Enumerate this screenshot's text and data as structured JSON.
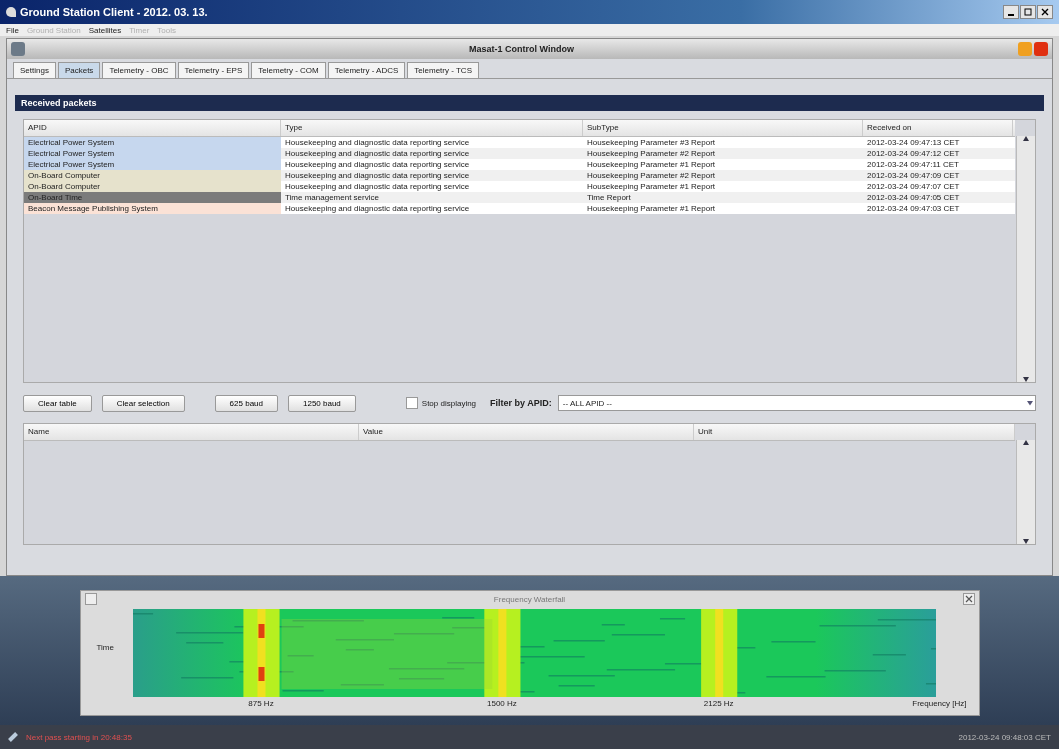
{
  "window": {
    "title": "Ground Station Client - 2012. 03. 13."
  },
  "menu": [
    {
      "label": "File",
      "disabled": false
    },
    {
      "label": "Ground Station",
      "disabled": true
    },
    {
      "label": "Satellites",
      "disabled": false
    },
    {
      "label": "Timer",
      "disabled": true
    },
    {
      "label": "Tools",
      "disabled": true
    }
  ],
  "control_window": {
    "title": "Masat-1 Control Window"
  },
  "tabs": [
    {
      "label": "Settings",
      "selected": false
    },
    {
      "label": "Packets",
      "selected": true
    },
    {
      "label": "Telemetry - OBC",
      "selected": false
    },
    {
      "label": "Telemetry - EPS",
      "selected": false
    },
    {
      "label": "Telemetry - COM",
      "selected": false
    },
    {
      "label": "Telemetry - ADCS",
      "selected": false
    },
    {
      "label": "Telemetry - TCS",
      "selected": false
    }
  ],
  "panel": {
    "title": "Received packets"
  },
  "packets": {
    "columns": [
      "APID",
      "Type",
      "SubType",
      "Received on"
    ],
    "rows": [
      {
        "apid": "Electrical Power System",
        "color": "#c6d7ee",
        "type": "Housekeeping and diagnostic data reporting service",
        "subtype": "Housekeeping Parameter #3 Report",
        "received": "2012-03-24 09:47:13 CET"
      },
      {
        "apid": "Electrical Power System",
        "color": "#c6d7ee",
        "type": "Housekeeping and diagnostic data reporting service",
        "subtype": "Housekeeping Parameter #2 Report",
        "received": "2012-03-24 09:47:12 CET"
      },
      {
        "apid": "Electrical Power System",
        "color": "#c6d7ee",
        "type": "Housekeeping and diagnostic data reporting service",
        "subtype": "Housekeeping Parameter #1 Report",
        "received": "2012-03-24 09:47:11 CET"
      },
      {
        "apid": "On-Board Computer",
        "color": "#e6e2cc",
        "type": "Housekeeping and diagnostic data reporting service",
        "subtype": "Housekeeping Parameter #2 Report",
        "received": "2012-03-24 09:47:09 CET"
      },
      {
        "apid": "On-Board Computer",
        "color": "#e6e2cc",
        "type": "Housekeeping and diagnostic data reporting service",
        "subtype": "Housekeeping Parameter #1 Report",
        "received": "2012-03-24 09:47:07 CET"
      },
      {
        "apid": "On-Board Time",
        "color": "#7b7b7b",
        "type": "Time management service",
        "subtype": "Time Report",
        "received": "2012-03-24 09:47:05 CET"
      },
      {
        "apid": "Beacon Message Publishing System",
        "color": "#fbe2d6",
        "type": "Housekeeping and diagnostic data reporting service",
        "subtype": "Housekeeping Parameter #1 Report",
        "received": "2012-03-24 09:47:03 CET"
      }
    ]
  },
  "buttons": [
    "Clear table",
    "Clear selection",
    "625 baud",
    "1250 baud"
  ],
  "stop_displaying": {
    "label": "Stop displaying",
    "checked": false
  },
  "filter": {
    "label": "Filter by APID:",
    "value": "-- ALL APID --"
  },
  "parameters": {
    "columns": [
      "Name",
      "Value",
      "Unit"
    ]
  },
  "waterfall": {
    "title": "Frequency Waterfall",
    "y_label": "Time",
    "x_labels": [
      "875 Hz",
      "1500 Hz",
      "2125 Hz"
    ],
    "x_title": "Frequency [Hz]"
  },
  "status_bar": {
    "message": "Next pass starting in 20:48:35",
    "time": "2012-03-24 09:48:03 CET"
  }
}
